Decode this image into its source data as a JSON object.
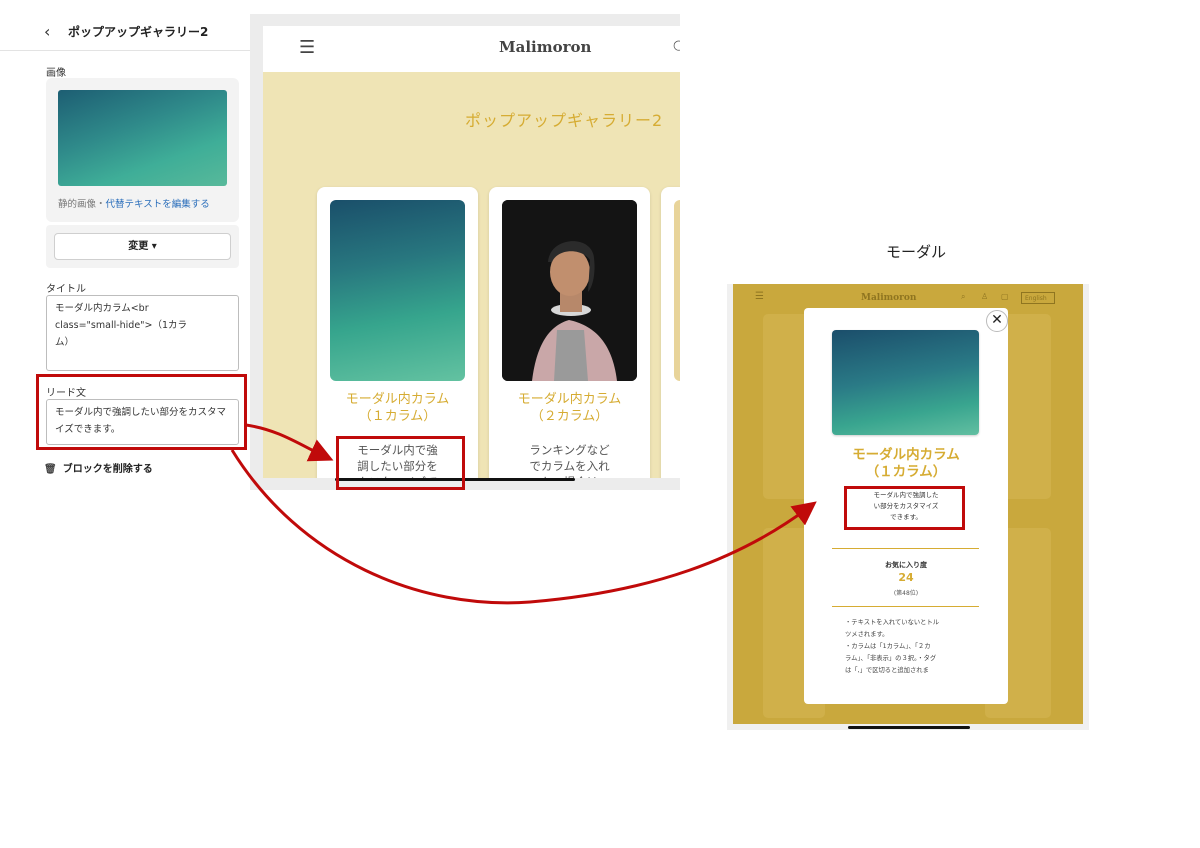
{
  "sidebar": {
    "back_icon": "chevron-left-icon",
    "title": "ポップアップギャラリー2",
    "image_label": "画像",
    "image_meta": "静的画像・",
    "image_meta_link": "代替テキストを編集する",
    "change_button": "変更 ▾",
    "title_label": "タイトル",
    "title_value": "モーダル内カラム<br\nclass=\"small-hide\">（1カラ\nム）",
    "lead_label": "リード文",
    "lead_value": "モーダル内で強調したい部分をカスタマ\nイズできます。",
    "delete_label": "ブロックを削除する"
  },
  "preview": {
    "menu_icon": "hamburger-icon",
    "brand": "Malimoron",
    "section_title": "ポップアップギャラリー2",
    "cards": [
      {
        "title": "モーダル内カラム\n（１カラム）",
        "lead": "モーダル内で強\n調したい部分を\nカスタマイズで"
      },
      {
        "title": "モーダル内カラム\n（２カラム）",
        "lead": "ランキングなど\nでカラムを入れ\nたい場合は"
      }
    ]
  },
  "modal_preview": {
    "caption": "モーダル",
    "brand": "Malimoron",
    "lang": "English",
    "close_icon": "close-icon",
    "title": "モーダル内カラム\n（１カラム）",
    "lead": "モーダル内で強調した\nい部分をカスタマイズ\nできます。",
    "fav_label": "お気に入り度",
    "fav_count": "24",
    "fav_rank": "(第48位)",
    "notes": "・テキストを入れていないとトル\nツメされます。\n・カラムは「1カラム」、「２カ\nラム」、「非表示」の３択。・タグ\nは「,」で区切ると追加されま"
  },
  "colors": {
    "accent": "#d6ac33",
    "highlight_red": "#c00a0a",
    "preview_bg": "#efe4b5",
    "overlay": "#c9a83d"
  }
}
